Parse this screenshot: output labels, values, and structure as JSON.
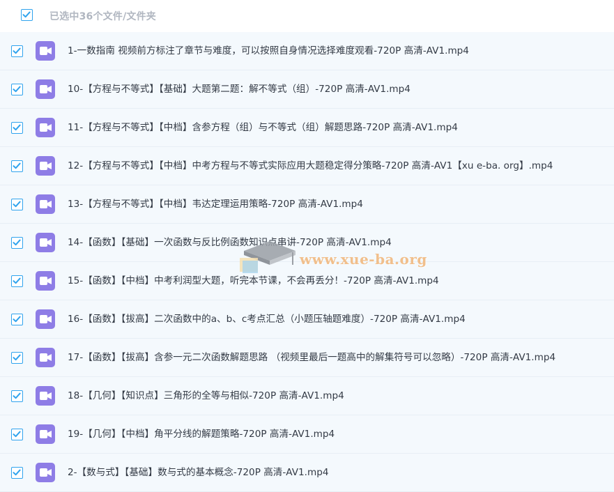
{
  "header": {
    "select_all_checked": true,
    "selection_summary": "已选中36个文件/文件夹"
  },
  "files": [
    {
      "name": "1-一数指南 视频前方标注了章节与难度，可以按照自身情况选择难度观看-720P 高清-AV1.mp4",
      "checked": true,
      "icon": "video-file-icon"
    },
    {
      "name": "10-【方程与不等式】【基础】大题第二题：解不等式（组）-720P 高清-AV1.mp4",
      "checked": true,
      "icon": "video-file-icon"
    },
    {
      "name": "11-【方程与不等式】【中档】含参方程（组）与不等式（组）解题思路-720P 高清-AV1.mp4",
      "checked": true,
      "icon": "video-file-icon"
    },
    {
      "name": "12-【方程与不等式】【中档】中考方程与不等式实际应用大题稳定得分策略-720P 高清-AV1【xu e-ba. org】.mp4",
      "checked": true,
      "icon": "video-file-icon"
    },
    {
      "name": "13-【方程与不等式】【中档】韦达定理运用策略-720P 高清-AV1.mp4",
      "checked": true,
      "icon": "video-file-icon"
    },
    {
      "name": "14-【函数】【基础】一次函数与反比例函数知识点串讲-720P 高清-AV1.mp4",
      "checked": true,
      "icon": "video-file-icon"
    },
    {
      "name": "15-【函数】【中档】中考利润型大题，听完本节课，不会再丢分！-720P 高清-AV1.mp4",
      "checked": true,
      "icon": "video-file-icon"
    },
    {
      "name": "16-【函数】【拔高】二次函数中的a、b、c考点汇总（小题压轴题难度）-720P 高清-AV1.mp4",
      "checked": true,
      "icon": "video-file-icon"
    },
    {
      "name": "17-【函数】【拔高】含参一元二次函数解题思路 （视频里最后一题高中的解集符号可以忽略）-720P 高清-AV1.mp4",
      "checked": true,
      "icon": "video-file-icon"
    },
    {
      "name": "18-【几何】【知识点】三角形的全等与相似-720P 高清-AV1.mp4",
      "checked": true,
      "icon": "video-file-icon"
    },
    {
      "name": "19-【几何】【中档】角平分线的解题策略-720P 高清-AV1.mp4",
      "checked": true,
      "icon": "video-file-icon"
    },
    {
      "name": "2-【数与式】【基础】数与式的基本概念-720P 高清-AV1.mp4",
      "checked": true,
      "icon": "video-file-icon"
    }
  ],
  "watermark": {
    "text": "www.xue-ba.org",
    "icon": "graduation-cap-icon"
  },
  "colors": {
    "checkbox_accent": "#2fa3ee",
    "video_icon_bg": "#8e7de6",
    "row_bg": "#f4f9fd",
    "header_text": "#b0b6c0",
    "file_text": "#333a45",
    "watermark_text": "#f1b679"
  }
}
